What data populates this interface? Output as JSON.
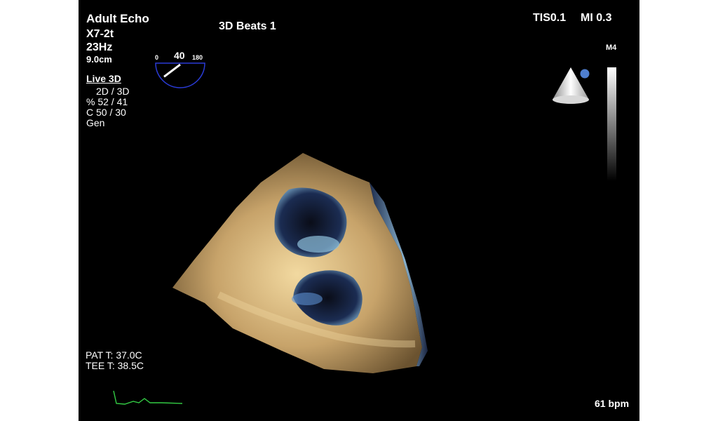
{
  "header": {
    "title": "Adult Echo",
    "probe": "X7-2t",
    "frame_rate": "23Hz",
    "depth": "9.0cm",
    "mode": "Live 3D",
    "params": [
      "2D / 3D",
      "% 52 / 41",
      "C  50 / 30",
      "Gen"
    ],
    "beats": "3D Beats 1"
  },
  "indices": {
    "tis": "TIS0.1",
    "mi": "MI 0.3"
  },
  "gray_map": {
    "label": "M4"
  },
  "omniplane": {
    "min_label": "0",
    "angle_label": "40",
    "max_label": "180",
    "angle_value": 40,
    "accent_color": "#2a3bd6"
  },
  "temperatures": {
    "patient": "PAT T: 37.0C",
    "tee": "TEE T: 38.5C"
  },
  "heart_rate": "61 bpm",
  "colors": {
    "background": "#000000",
    "text": "#ffffff",
    "ecg_trace": "#33cc44",
    "orientation_dot": "#4f7fd0",
    "tissue": "#c9a870",
    "chamber": "#6aa0c8"
  },
  "icons": {
    "orientation": "probe-orientation-icon",
    "omniplane": "omniplane-indicator-icon"
  }
}
